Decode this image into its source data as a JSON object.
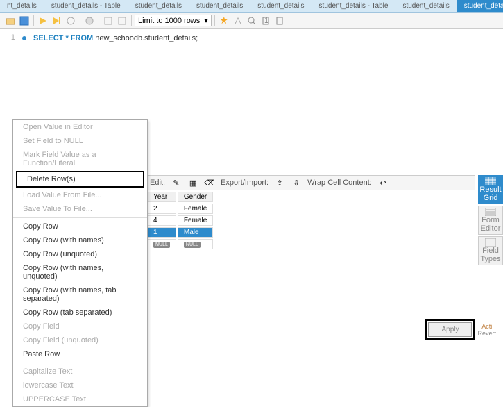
{
  "tabs": [
    {
      "label": "nt_details"
    },
    {
      "label": "student_details - Table"
    },
    {
      "label": "student_details"
    },
    {
      "label": "student_details"
    },
    {
      "label": "student_details"
    },
    {
      "label": "student_details - Table"
    },
    {
      "label": "student_details"
    },
    {
      "label": "student_details",
      "active": true
    }
  ],
  "toolbar": {
    "limit_label": "Limit to 1000 rows"
  },
  "editor": {
    "line": "1",
    "sql_keywords": "SELECT * FROM",
    "sql_rest": " new_schoodb.student_details;"
  },
  "result_toolbar": {
    "edit_label": "Edit:",
    "export_label": "Export/Import:",
    "wrap_label": "Wrap Cell Content:"
  },
  "grid": {
    "headers": [
      "Year",
      "Gender"
    ],
    "rows": [
      {
        "year": "2",
        "gender": "Female",
        "selected": false
      },
      {
        "year": "4",
        "gender": "Female",
        "selected": false
      },
      {
        "year": "1",
        "gender": "Male",
        "selected": true
      },
      {
        "year": "NULL",
        "gender": "NULL",
        "selected": false,
        "null": true
      }
    ]
  },
  "side_panel": {
    "result_grid": "Result Grid",
    "form_editor": "Form Editor",
    "field_types": "Field Types"
  },
  "apply": {
    "apply_label": "Apply",
    "revert_label": "Revert",
    "action_label": "Acti"
  },
  "context_menu": {
    "open_value": "Open Value in Editor",
    "set_null": "Set Field to NULL",
    "mark_func": "Mark Field Value as a Function/Literal",
    "delete_rows": "Delete Row(s)",
    "load_file": "Load Value From File...",
    "save_file": "Save Value To File...",
    "copy_row": "Copy Row",
    "copy_row_names": "Copy Row (with names)",
    "copy_row_unq": "Copy Row (unquoted)",
    "copy_row_names_unq": "Copy Row (with names, unquoted)",
    "copy_row_tab": "Copy Row (with names, tab separated)",
    "copy_row_tab2": "Copy Row (tab separated)",
    "copy_field": "Copy Field",
    "copy_field_unq": "Copy Field (unquoted)",
    "paste_row": "Paste Row",
    "capitalize": "Capitalize Text",
    "lowercase": "lowercase Text",
    "uppercase": "UPPERCASE Text"
  }
}
